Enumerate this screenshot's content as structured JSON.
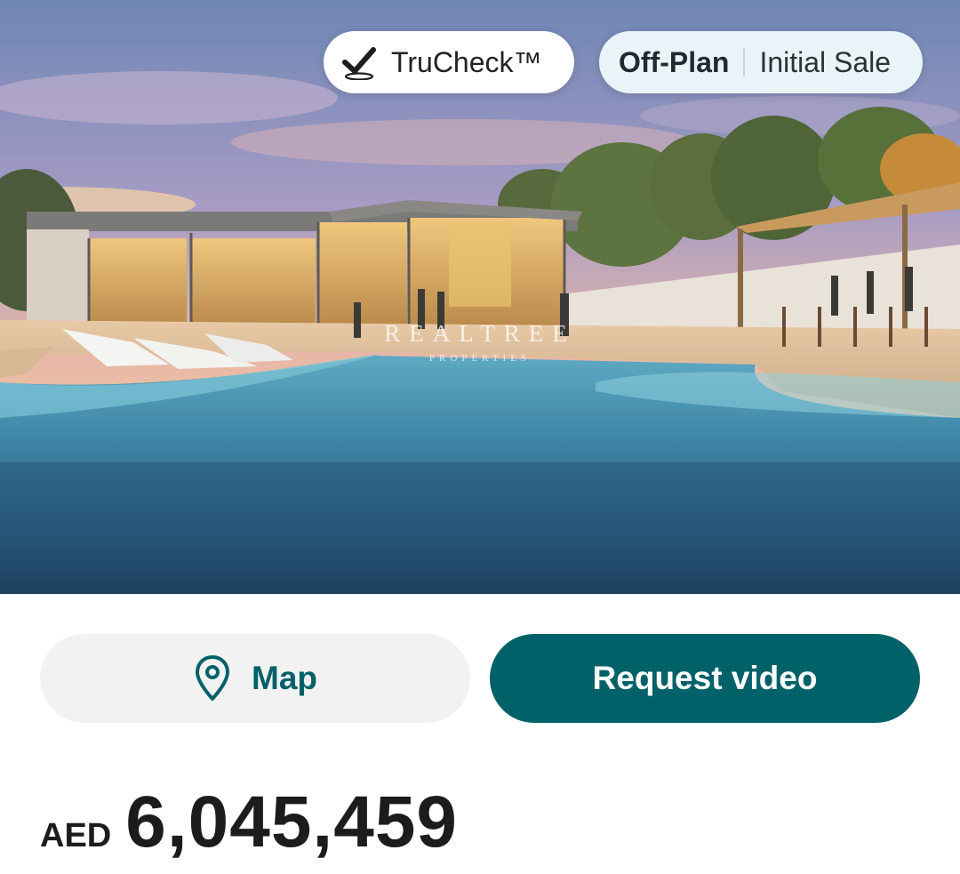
{
  "listing": {
    "badges": {
      "trucheck": {
        "label": "TruCheck™",
        "icon": "check-icon"
      },
      "status": {
        "primary": "Off-Plan",
        "secondary": "Initial Sale"
      }
    },
    "image": {
      "watermark_main": "REALTREE",
      "watermark_sub": "PROPERTIES"
    }
  },
  "actions": {
    "map": {
      "label": "Map",
      "icon": "location-pin-icon"
    },
    "request_video": {
      "label": "Request video"
    }
  },
  "price": {
    "currency": "AED",
    "amount": "6,045,459"
  },
  "colors": {
    "accent": "#006169",
    "status_pill_bg": "#e9f4f8",
    "map_button_bg": "#f2f2f2"
  }
}
